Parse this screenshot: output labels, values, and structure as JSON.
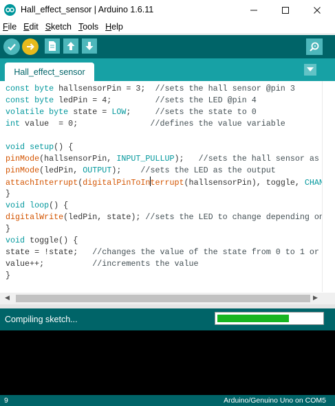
{
  "window": {
    "title": "Hall_effect_sensor | Arduino 1.6.11",
    "minimize_symbol": "—",
    "maximize_symbol": "☐",
    "close_symbol": "✕"
  },
  "menu": {
    "items": [
      {
        "key": "F",
        "rest": "ile"
      },
      {
        "key": "E",
        "rest": "dit"
      },
      {
        "key": "S",
        "rest": "ketch"
      },
      {
        "key": "T",
        "rest": "ools"
      },
      {
        "key": "H",
        "rest": "elp"
      }
    ]
  },
  "toolbar": {
    "buttons": [
      "verify-icon",
      "upload-icon",
      "new-sketch-icon",
      "open-icon",
      "save-icon"
    ],
    "serial_monitor": "serial-monitor-icon"
  },
  "tabs": {
    "active": "Hall_effect_sensor",
    "menu_icon": "chevron-down-icon"
  },
  "editor": {
    "lines": [
      {
        "parts": [
          {
            "t": "const byte",
            "c": "kw"
          },
          {
            "t": " hallsensorPin = 3;  ",
            "c": ""
          },
          {
            "t": "//sets the hall sensor @pin 3",
            "c": "cmt"
          }
        ]
      },
      {
        "parts": [
          {
            "t": "const byte",
            "c": "kw"
          },
          {
            "t": " ledPin = 4;         ",
            "c": ""
          },
          {
            "t": "//sets the LED @pin 4",
            "c": "cmt"
          }
        ]
      },
      {
        "parts": [
          {
            "t": "volatile byte",
            "c": "kw"
          },
          {
            "t": " state = ",
            "c": ""
          },
          {
            "t": "LOW",
            "c": "const"
          },
          {
            "t": ";     ",
            "c": ""
          },
          {
            "t": "//sets the state to 0",
            "c": "cmt"
          }
        ]
      },
      {
        "parts": [
          {
            "t": "int",
            "c": "kw"
          },
          {
            "t": " value  = 0;               ",
            "c": ""
          },
          {
            "t": "//defines the value variable",
            "c": "cmt"
          }
        ]
      },
      {
        "parts": []
      },
      {
        "parts": [
          {
            "t": "void",
            "c": "kw"
          },
          {
            "t": " ",
            "c": ""
          },
          {
            "t": "setup",
            "c": "kw"
          },
          {
            "t": "() {",
            "c": ""
          }
        ]
      },
      {
        "parts": [
          {
            "t": "pinMode",
            "c": "fn"
          },
          {
            "t": "(hallsensorPin, ",
            "c": ""
          },
          {
            "t": "INPUT_PULLUP",
            "c": "const"
          },
          {
            "t": ");   ",
            "c": ""
          },
          {
            "t": "//sets the hall sensor as",
            "c": "cmt"
          }
        ]
      },
      {
        "parts": [
          {
            "t": "pinMode",
            "c": "fn"
          },
          {
            "t": "(ledPin, ",
            "c": ""
          },
          {
            "t": "OUTPUT",
            "c": "const"
          },
          {
            "t": ");    ",
            "c": ""
          },
          {
            "t": "//sets the LED as the output",
            "c": "cmt"
          }
        ]
      },
      {
        "parts": [
          {
            "t": "attachInterrupt",
            "c": "fn"
          },
          {
            "t": "(",
            "c": ""
          },
          {
            "t": "digitalPinToIn",
            "c": "fn"
          },
          {
            "t": "",
            "c": "caret"
          },
          {
            "t": "terrupt",
            "c": "fn"
          },
          {
            "t": "(hallsensorPin), toggle, ",
            "c": ""
          },
          {
            "t": "CHAN",
            "c": "const"
          }
        ]
      },
      {
        "parts": [
          {
            "t": "}",
            "c": ""
          }
        ]
      },
      {
        "parts": [
          {
            "t": "void",
            "c": "kw"
          },
          {
            "t": " ",
            "c": ""
          },
          {
            "t": "loop",
            "c": "kw"
          },
          {
            "t": "() {",
            "c": ""
          }
        ]
      },
      {
        "parts": [
          {
            "t": "digitalWrite",
            "c": "fn"
          },
          {
            "t": "(ledPin, state); ",
            "c": ""
          },
          {
            "t": "//sets the LED to change depending on",
            "c": "cmt"
          }
        ]
      },
      {
        "parts": [
          {
            "t": "}",
            "c": ""
          }
        ]
      },
      {
        "parts": [
          {
            "t": "void",
            "c": "kw"
          },
          {
            "t": " toggle() {",
            "c": ""
          }
        ]
      },
      {
        "parts": [
          {
            "t": "state = !state;   ",
            "c": ""
          },
          {
            "t": "//changes the value of the state from 0 to 1 or",
            "c": "cmt"
          }
        ]
      },
      {
        "parts": [
          {
            "t": "value++;          ",
            "c": ""
          },
          {
            "t": "//increments the value",
            "c": "cmt"
          }
        ]
      },
      {
        "parts": [
          {
            "t": "}",
            "c": ""
          }
        ]
      }
    ]
  },
  "status": {
    "message": "Compiling sketch...",
    "progress": 0.68
  },
  "footer": {
    "line_number": "9",
    "board": "Arduino/Genuino Uno on COM5"
  },
  "colors": {
    "toolbar": "#006468",
    "tabbar": "#17a1a5",
    "keyword": "#00979c",
    "function": "#d35400",
    "progress": "#18b521"
  }
}
